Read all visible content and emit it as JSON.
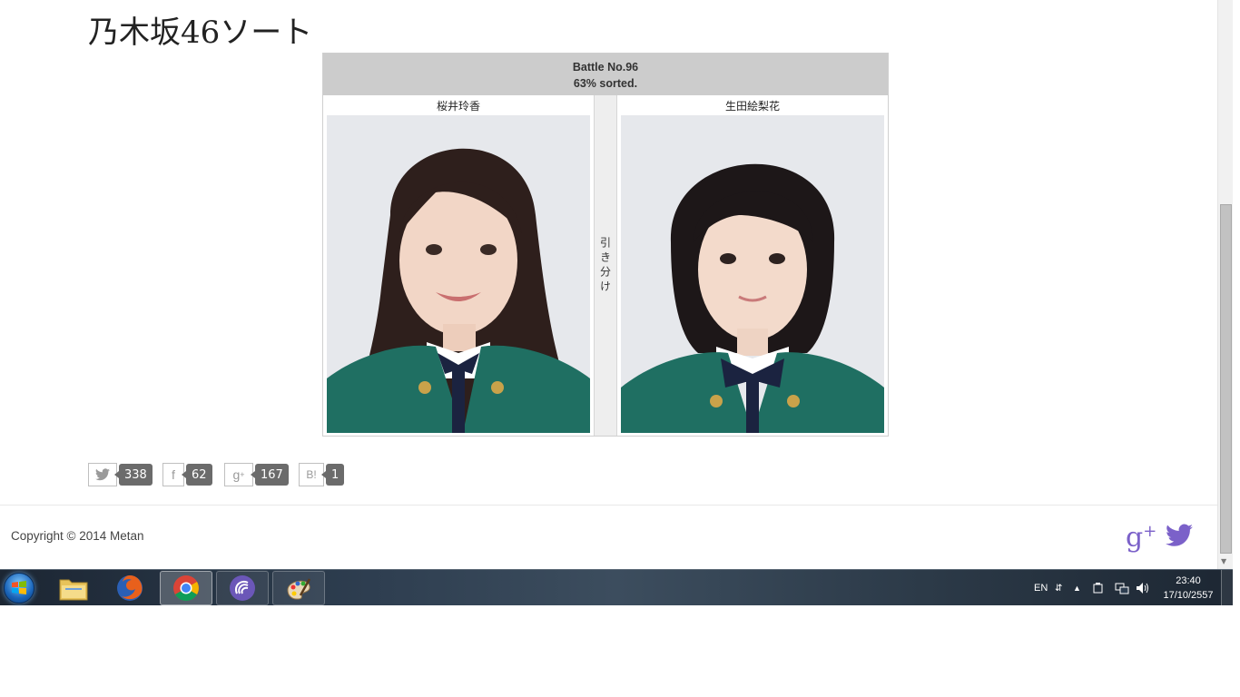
{
  "site": {
    "title": "乃木坂46ソート"
  },
  "battle": {
    "number_label": "Battle No.96",
    "progress_label": "63% sorted.",
    "left_name": "桜井玲香",
    "right_name": "生田絵梨花",
    "tie_label": "引き分け"
  },
  "shares": {
    "twitter_count": "338",
    "facebook_count": "62",
    "googleplus_count": "167",
    "hatena_label": "B!",
    "hatena_count": "1"
  },
  "footer": {
    "copyright": "Copyright © 2014 Metan"
  },
  "taskbar": {
    "language": "EN",
    "time": "23:40",
    "date": "17/10/2557"
  },
  "colors": {
    "accent_social": "#7b61c9",
    "battle_header": "#cccccc"
  }
}
